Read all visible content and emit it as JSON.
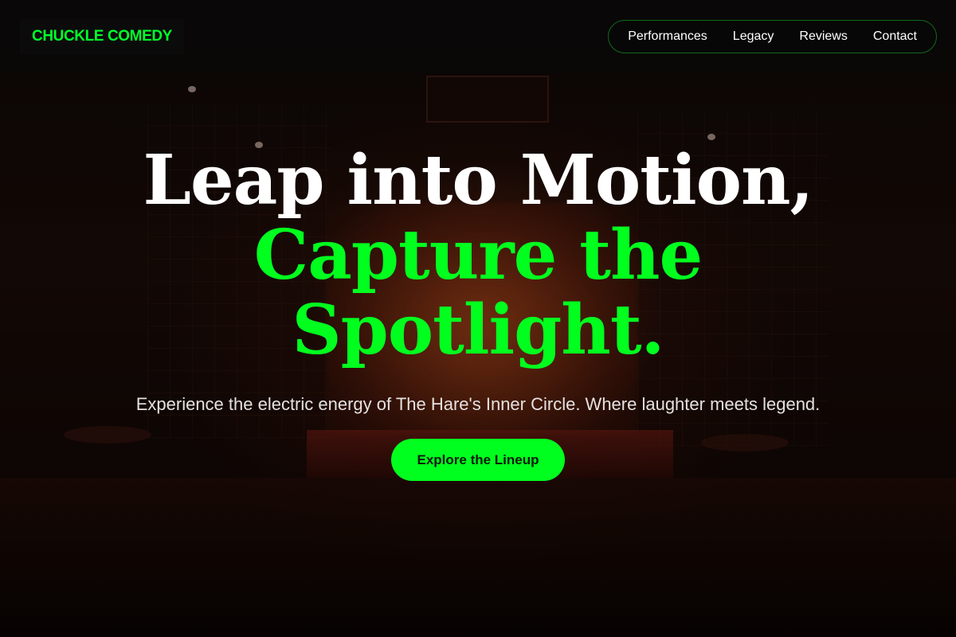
{
  "header": {
    "brand": "CHUCKLE COMEDY",
    "nav": [
      {
        "label": "Performances"
      },
      {
        "label": "Legacy"
      },
      {
        "label": "Reviews"
      },
      {
        "label": "Contact"
      }
    ]
  },
  "hero": {
    "headline_line1": "Leap into Motion,",
    "headline_line2": "Capture the",
    "headline_line3": "Spotlight.",
    "subtitle": "Experience the electric energy of The Hare's Inner Circle. Where laughter meets legend.",
    "cta_label": "Explore the Lineup"
  },
  "colors": {
    "accent": "#00ff1e",
    "nav_border": "#0f6a1e",
    "brand_text": "#00ff2a"
  }
}
